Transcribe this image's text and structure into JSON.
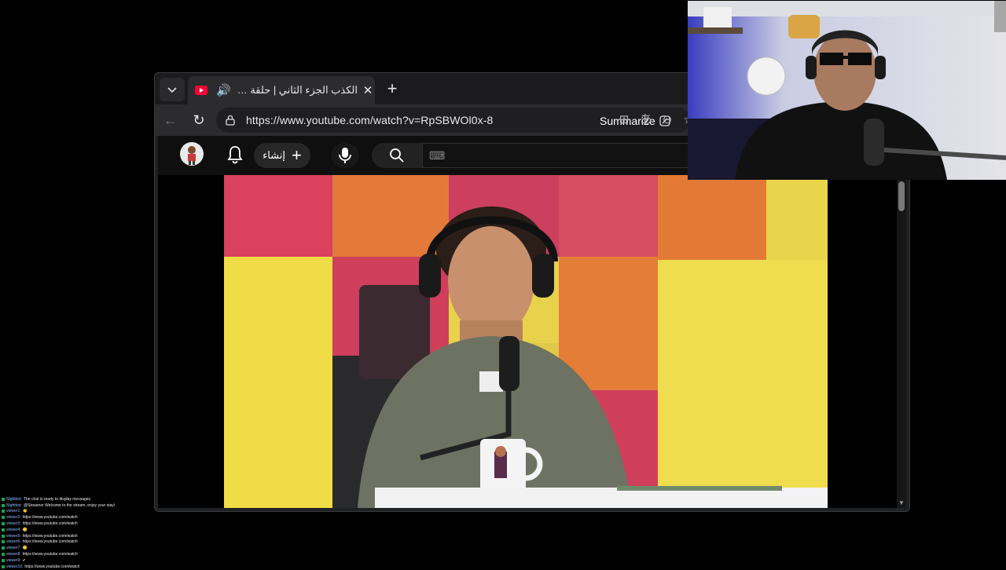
{
  "browser": {
    "tab": {
      "title": "الكذب الجزء الثاني | حلقة لايف م...",
      "audio": "🔊",
      "close": "✕"
    },
    "new_tab": "+",
    "tab_list": "⌄",
    "nav": {
      "back": "←",
      "reload": "↻"
    },
    "url": "https://www.youtube.com/watch?v=RpSBWOl0x-8",
    "summarize_label": "Summarize",
    "toolbar_icons": [
      "extensions-icon",
      "translate-icon",
      "zoom-out-icon",
      "favorite-icon"
    ],
    "toolbar_glyphs": {
      "extensions": "⊞",
      "translate": "あ",
      "zoom": "⊖",
      "favorite": "☆"
    }
  },
  "youtube": {
    "create_label": "إنشاء",
    "create_plus": "+",
    "search_hint": "⌨",
    "accent": "#ff0033"
  },
  "player": {
    "scroll_down": "▼"
  },
  "chat": {
    "lines": [
      {
        "user": "Nightbot:",
        "msg": "The chat is ready to display messages."
      },
      {
        "user": "Nightbot:",
        "msg": "@Streamer Welcome to the stream, enjoy your stay!"
      },
      {
        "user": "viewer1:",
        "msg": "👏"
      },
      {
        "user": "viewer2:",
        "msg": "https://www.youtube.com/watch"
      },
      {
        "user": "viewer3:",
        "msg": "https://www.youtube.com/watch"
      },
      {
        "user": "viewer4:",
        "msg": "🙂"
      },
      {
        "user": "viewer5:",
        "msg": "https://www.youtube.com/watch"
      },
      {
        "user": "viewer6:",
        "msg": "https://www.youtube.com/watch"
      },
      {
        "user": "viewer7:",
        "msg": "🙂"
      },
      {
        "user": "viewer8:",
        "msg": "https://www.youtube.com/watch"
      },
      {
        "user": "viewer9:",
        "msg": "✔"
      },
      {
        "user": "viewer10:",
        "msg": "https://www.youtube.com/watch"
      }
    ]
  }
}
